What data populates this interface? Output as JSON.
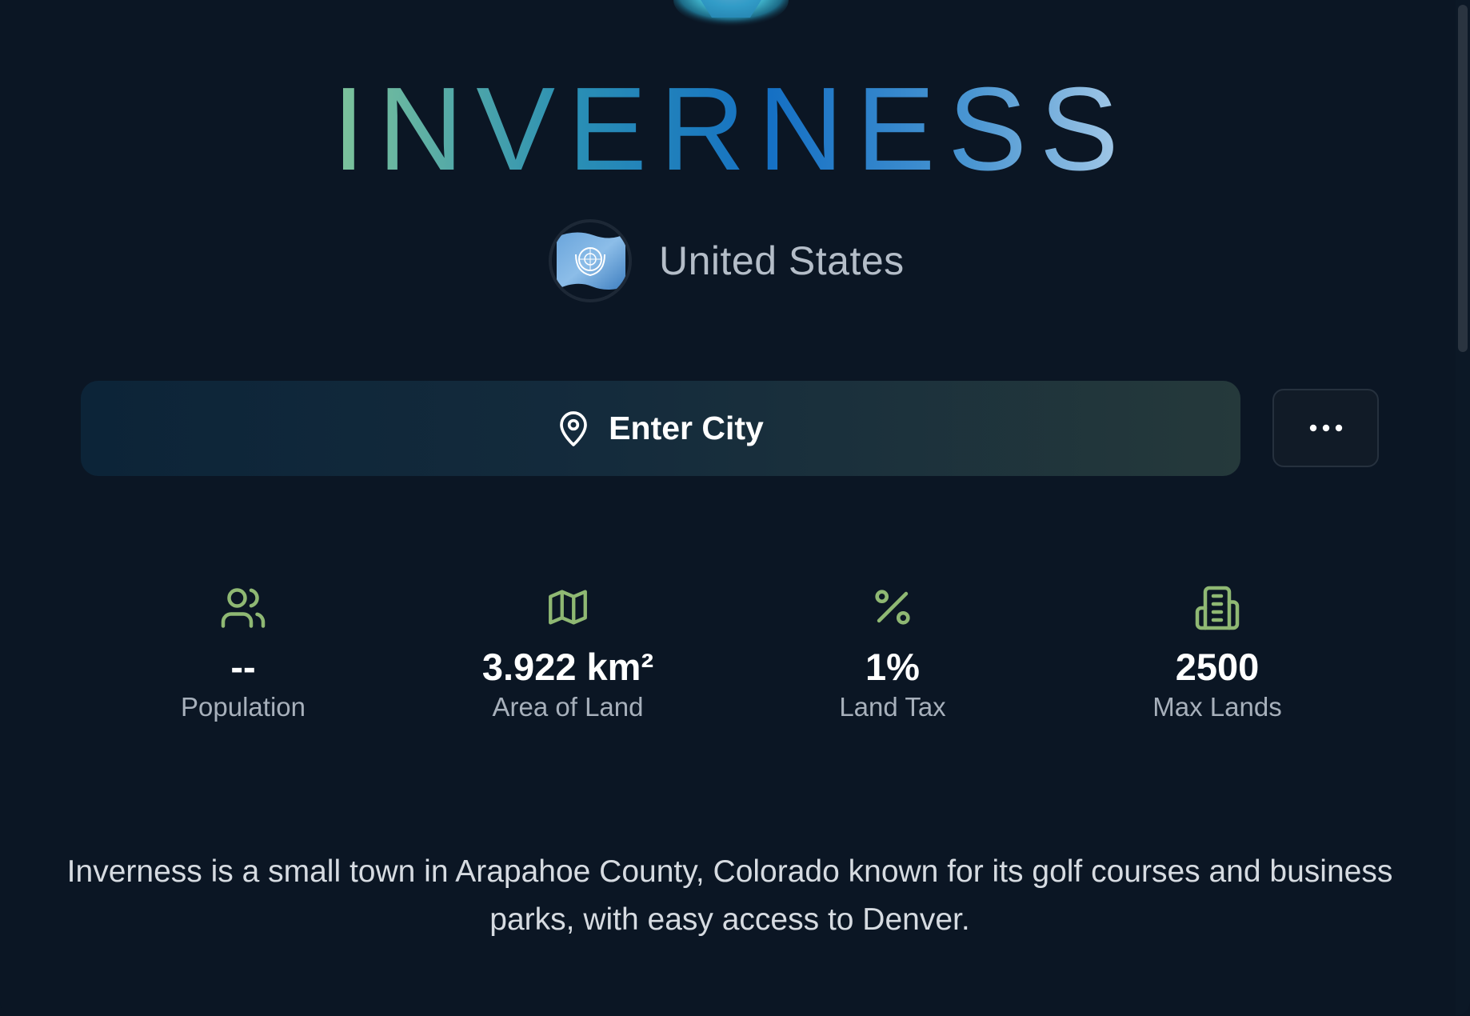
{
  "city": {
    "name": "INVERNESS",
    "country": "United States",
    "flag_icon": "un-flag-icon"
  },
  "actions": {
    "enter_city_label": "Enter City",
    "enter_city_icon": "map-pin-icon",
    "more_icon": "more-horizontal-icon"
  },
  "stats": [
    {
      "icon": "users-icon",
      "value": "--",
      "label": "Population"
    },
    {
      "icon": "map-icon",
      "value": "3.922 km²",
      "label": "Area of Land"
    },
    {
      "icon": "percent-icon",
      "value": "1%",
      "label": "Land Tax"
    },
    {
      "icon": "building-icon",
      "value": "2500",
      "label": "Max Lands"
    }
  ],
  "description": "Inverness is a small town in Arapahoe County, Colorado known for its golf courses and business parks, with easy access to Denver.",
  "colors": {
    "background": "#0b1624",
    "accent_green": "#8fb873",
    "logo_gradient": [
      "#7fc49a",
      "#2a8bb0",
      "#1a6fc4",
      "#9fc6e6"
    ]
  }
}
